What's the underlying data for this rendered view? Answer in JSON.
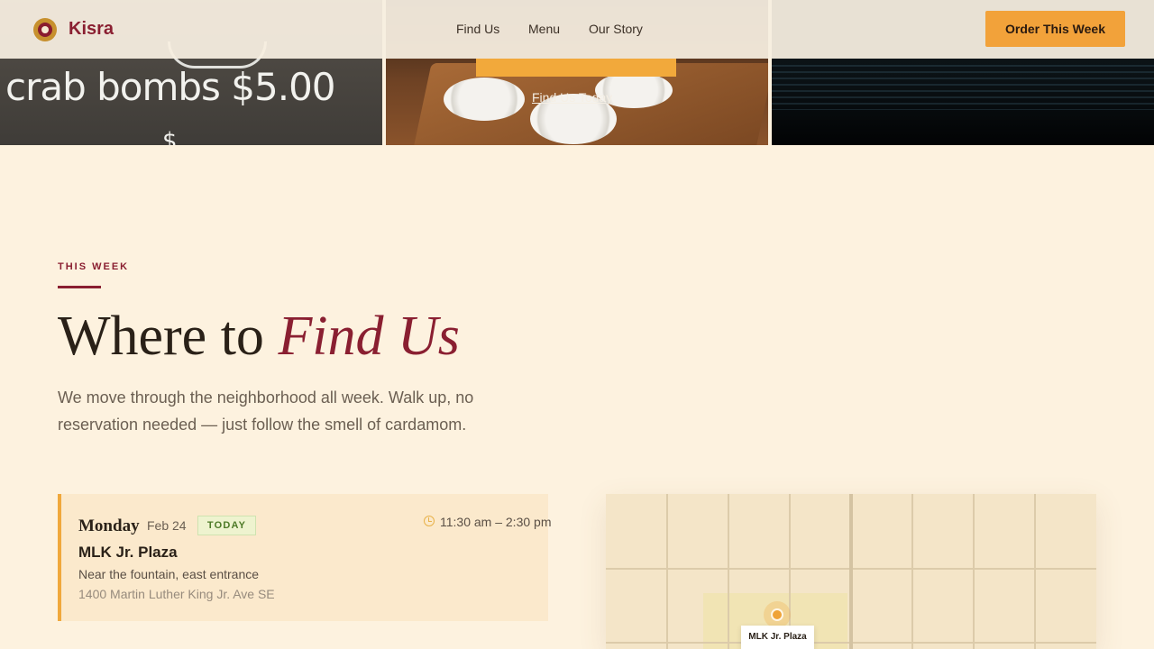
{
  "header": {
    "brand": "Kisra",
    "nav": [
      "Find Us",
      "Menu",
      "Our Story"
    ],
    "cta": "Order This Week"
  },
  "hero": {
    "chalkboard_text": "crab bombs $5.00",
    "photo_link": "Find Us Today"
  },
  "section": {
    "eyebrow": "THIS WEEK",
    "headline_plain": "Where to ",
    "headline_accent": "Find Us",
    "lede": "We move through the neighborhood all week. Walk up, no reservation needed — just follow the smell of cardamom."
  },
  "location": {
    "day": "Monday",
    "date": "Feb 24",
    "badge": "TODAY",
    "hours": "11:30 am – 2:30 pm",
    "place": "MLK Jr. Plaza",
    "note": "Near the fountain, east entrance",
    "address": "1400 Martin Luther King Jr. Ave SE"
  },
  "map": {
    "pin_label": "MLK Jr. Plaza"
  },
  "colors": {
    "brand": "#8a1f31",
    "accent": "#f2a23a",
    "background": "#fdf2df"
  }
}
